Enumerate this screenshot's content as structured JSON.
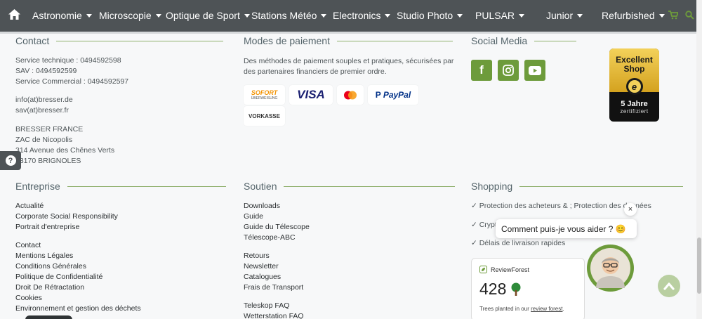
{
  "nav": {
    "items": [
      "Astronomie",
      "Microscopie",
      "Optique de Sport",
      "Stations Météo",
      "Electronics",
      "Studio Photo",
      "PULSAR",
      "Junior",
      "Refurbished"
    ]
  },
  "contact": {
    "title": "Contact",
    "lines1": [
      "Service technique : 0494592598",
      "SAV : 0494592599",
      "Service Commercial : 0494592597"
    ],
    "lines2": [
      "info(at)bresser.de",
      "sav(at)bresser.fr"
    ],
    "lines3": [
      "BRESSER FRANCE",
      "ZAC de Nicopolis",
      "314 Avenue des Chênes Verts",
      "83170 BRIGNOLES"
    ]
  },
  "payment": {
    "title": "Modes de paiement",
    "description": "Des méthodes de paiement souples et pratiques, sécurisées par des partenaires financiers de premier ordre.",
    "methods": [
      "SOFORT",
      "ÜBERWEISUNG",
      "VISA",
      "PayPal",
      "VORKASSE"
    ]
  },
  "social": {
    "title": "Social Media"
  },
  "badge": {
    "line1": "Excellent",
    "line2": "Shop",
    "line3": "5 Jahre",
    "line4": "zertifiziert",
    "logo": "e"
  },
  "entreprise": {
    "title": "Entreprise",
    "group1": [
      "Actualité",
      "Corporate Social Responsibility",
      "Portrait d'entreprise"
    ],
    "group2": [
      "Contact",
      "Mentions Légales",
      "Conditions Générales",
      "Politique de Confidentialité",
      "Droit De Rétractation",
      "Cookies",
      "Environnement et gestion des déchets"
    ]
  },
  "soutien": {
    "title": "Soutien",
    "group1": [
      "Downloads",
      "Guide",
      "Guide du Télescope",
      "Télescope-ABC"
    ],
    "group2": [
      "Retours",
      "Newsletter",
      "Catalogues",
      "Frais de Transport"
    ],
    "group3": [
      "Teleskop FAQ",
      "Wetterstation FAQ"
    ]
  },
  "shopping": {
    "title": "Shopping",
    "items": [
      "✓ Protection des acheteurs & ; Protection des données",
      "✓ Crypt",
      "✓ Délais de livraison rapides"
    ]
  },
  "chat": {
    "message": "Comment puis-je vous aider ? 😊",
    "close": "×"
  },
  "review": {
    "brand": "ReviewForest",
    "count": "428",
    "text_prefix": "Trees planted in our ",
    "text_link": "review forest",
    "text_suffix": "."
  },
  "help": {
    "label": "?"
  },
  "colors": {
    "nav": "#4e5356",
    "accent": "#6d9b3b",
    "bg": "#f7f8f9"
  }
}
